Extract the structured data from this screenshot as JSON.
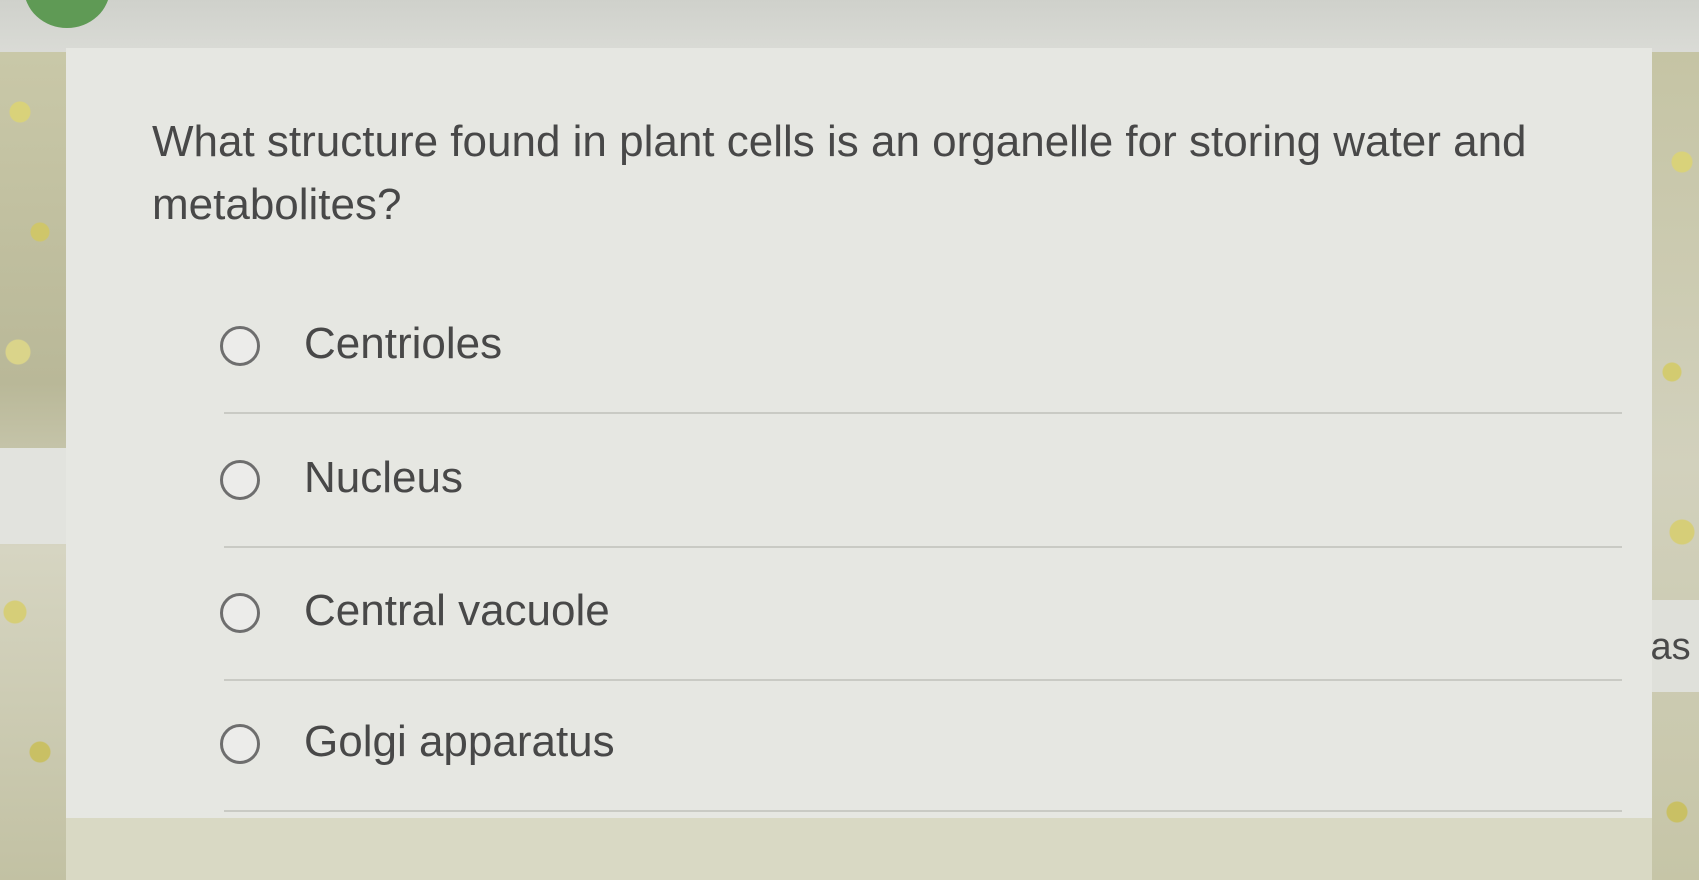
{
  "question": {
    "text": "What structure found in plant cells is an organelle for storing water and metabolites?"
  },
  "options": [
    {
      "label": "Centrioles",
      "selected": false
    },
    {
      "label": "Nucleus",
      "selected": false
    },
    {
      "label": "Central vacuole",
      "selected": false
    },
    {
      "label": "Golgi apparatus",
      "selected": false
    }
  ],
  "background": {
    "right_partial_text": "las"
  },
  "colors": {
    "card": "#e6e7e2",
    "text": "#484848",
    "radio_border": "#6e6e6e",
    "badge": "#5f9a55"
  }
}
